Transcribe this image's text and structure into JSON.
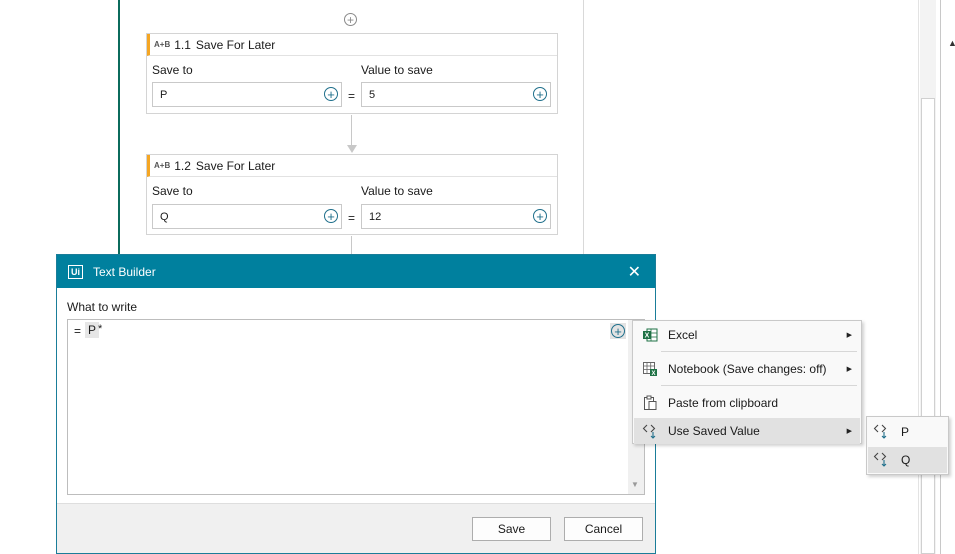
{
  "workflow": {
    "activities": [
      {
        "number": "1.1",
        "title": "Save For Later",
        "badge": "A+B",
        "save_to_label": "Save to",
        "save_to_value": "P",
        "equals": "=",
        "value_label": "Value to save",
        "value": "5"
      },
      {
        "number": "1.2",
        "title": "Save For Later",
        "badge": "A+B",
        "save_to_label": "Save to",
        "save_to_value": "Q",
        "equals": "=",
        "value_label": "Value to save",
        "value": "12"
      }
    ]
  },
  "dialog": {
    "logo": "Ui",
    "title": "Text Builder",
    "close_glyph": "✕",
    "what_to_write_label": "What to write",
    "editor": {
      "equals": "=",
      "token": "P",
      "suffix": "*"
    },
    "save_label": "Save",
    "cancel_label": "Cancel"
  },
  "context_menu": {
    "items": [
      {
        "label": "Excel",
        "icon": "excel-icon",
        "has_submenu": true
      },
      {
        "label": "Notebook (Save changes: off)",
        "icon": "notebook-icon",
        "has_submenu": true
      },
      {
        "label": "Paste from clipboard",
        "icon": "clipboard-icon",
        "has_submenu": false
      },
      {
        "label": "Use Saved Value",
        "icon": "saved-value-icon",
        "has_submenu": true,
        "highlighted": true
      }
    ]
  },
  "saved_values_submenu": {
    "items": [
      {
        "label": "P",
        "icon": "saved-value-icon"
      },
      {
        "label": "Q",
        "icon": "saved-value-icon",
        "highlighted": true
      }
    ]
  },
  "colors": {
    "dialog_title_bar": "#00809e",
    "activity_accent": "#f5a623",
    "excel_green": "#1e7145",
    "plus_teal": "#1f6f8b",
    "flow_line": "#0b6b5c"
  }
}
